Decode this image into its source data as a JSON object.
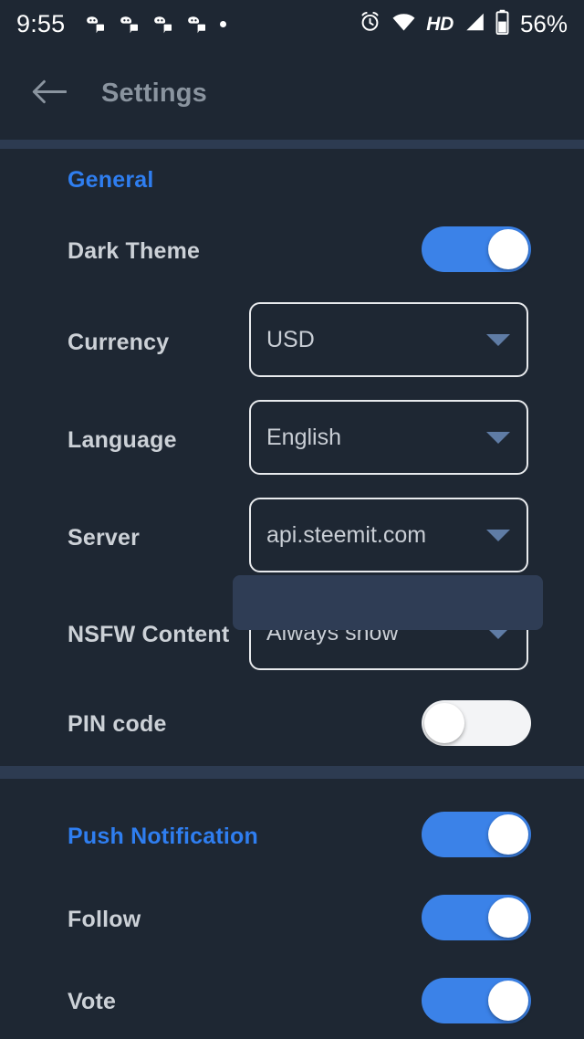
{
  "statusbar": {
    "time": "9:55",
    "notification_icons": [
      "discord-icon",
      "discord-icon",
      "discord-icon",
      "discord-icon"
    ],
    "overflow_dot": "more-notifications-dot",
    "alarm_icon": "alarm-clock-icon",
    "wifi_icon": "wifi-icon",
    "hd_label": "HD",
    "signal_icon": "cell-signal-icon",
    "battery_icon": "battery-icon",
    "battery_percent": "56%"
  },
  "appbar": {
    "back_icon": "back-arrow-icon",
    "title": "Settings"
  },
  "sections": [
    {
      "header": "General",
      "rows": [
        {
          "label": "Dark Theme",
          "control": "toggle",
          "value": "on"
        },
        {
          "label": "Currency",
          "control": "dropdown",
          "value": "USD"
        },
        {
          "label": "Language",
          "control": "dropdown",
          "value": "English"
        },
        {
          "label": "Server",
          "control": "dropdown",
          "value": "api.steemit.com"
        },
        {
          "label": "NSFW Content",
          "control": "dropdown",
          "value": "Always show"
        },
        {
          "label": "PIN code",
          "control": "toggle",
          "value": "off"
        }
      ]
    },
    {
      "header": "Push Notification",
      "header_control": "toggle",
      "header_value": "on",
      "rows": [
        {
          "label": "Follow",
          "control": "toggle",
          "value": "on"
        },
        {
          "label": "Vote",
          "control": "toggle",
          "value": "on"
        }
      ]
    }
  ],
  "overlay": {
    "name": "dropdown-popup-panel"
  },
  "colors": {
    "background": "#1e2733",
    "accent_blue": "#2f7ef0",
    "toggle_on": "#3b82e8",
    "toggle_off": "#f3f4f6",
    "label_text": "#ccd1d7",
    "title_text": "#8a949f",
    "divider": "#2d3b51",
    "overlay_panel": "#2f3d55",
    "dropdown_border": "#e8eaed",
    "caret": "#5f7ca5"
  }
}
